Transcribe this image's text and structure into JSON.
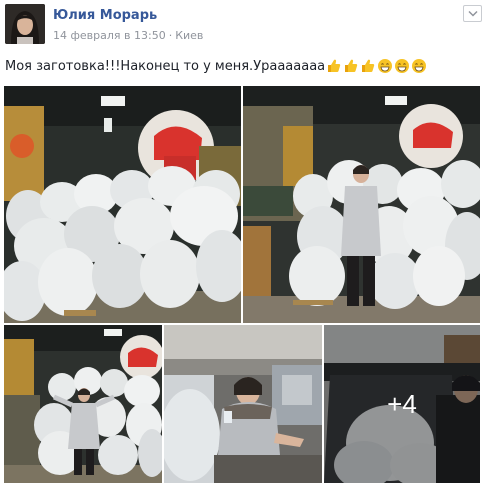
{
  "post": {
    "author": "Юлия Морарь",
    "date": "14 февраля в 13:50",
    "separator": "·",
    "location": "Киев",
    "text": "Моя заготовка!!!Наконец то у меня.Урааааааа",
    "emojis": [
      "thumbs-up-icon",
      "thumbs-up-icon",
      "thumbs-up-icon",
      "grinning-face-icon",
      "grinning-face-icon",
      "grinning-face-icon"
    ],
    "more_photos_label": "+4"
  },
  "colors": {
    "author_link": "#365899",
    "meta_gray": "#90949c",
    "text": "#1d2129",
    "emoji_yellow": "#f7c325"
  }
}
